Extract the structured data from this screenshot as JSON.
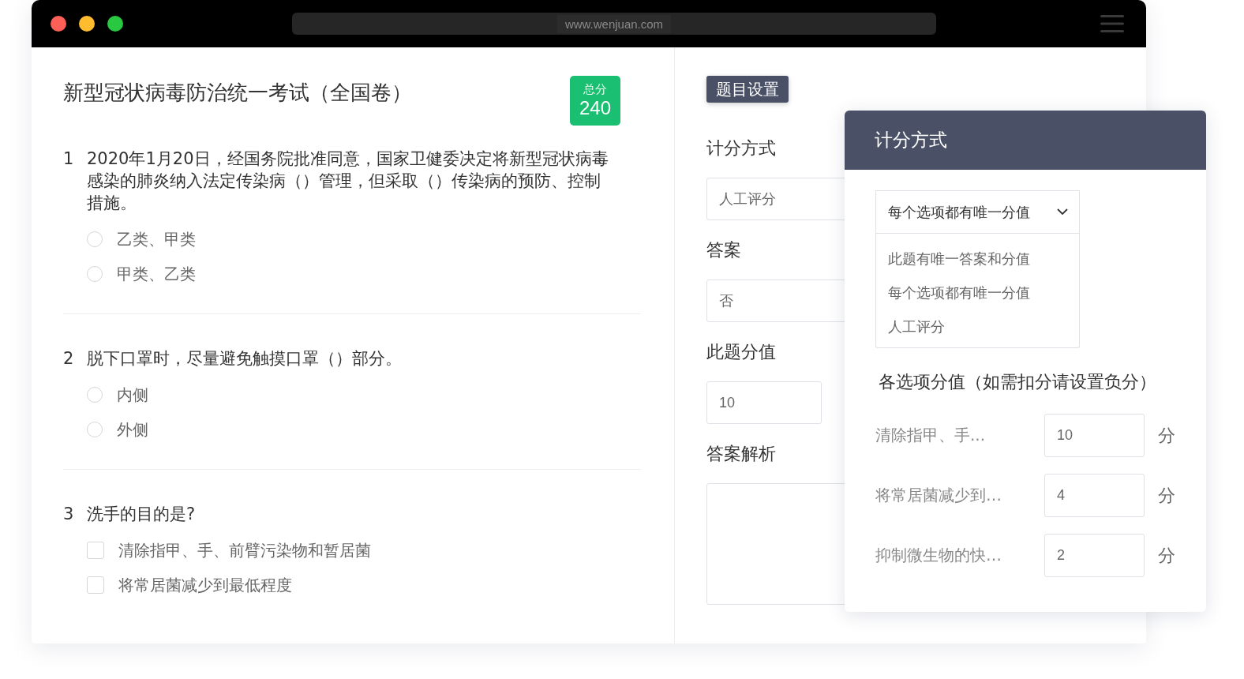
{
  "browser": {
    "url": "www.wenjuan.com"
  },
  "exam": {
    "title": "新型冠状病毒防治统一考试（全国卷）",
    "total_score": {
      "label": "总分",
      "value": "240"
    },
    "questions": [
      {
        "number": "1",
        "text": "2020年1月20日，经国务院批准同意，国家卫健委决定将新型冠状病毒感染的肺炎纳入法定传染病（）管理，但采取（）传染病的预防、控制措施。",
        "kind": "single",
        "options": [
          {
            "label": "乙类、甲类",
            "checked": false
          },
          {
            "label": "甲类、乙类",
            "checked": false
          }
        ]
      },
      {
        "number": "2",
        "text": "脱下口罩时，尽量避免触摸口罩（）部分。",
        "kind": "single",
        "options": [
          {
            "label": "内侧",
            "checked": false
          },
          {
            "label": "外侧",
            "checked": false
          }
        ]
      },
      {
        "number": "3",
        "text": "洗手的目的是?",
        "kind": "multiple",
        "options": [
          {
            "label": "清除指甲、手、前臂污染物和暂居菌",
            "checked": false
          },
          {
            "label": "将常居菌减少到最低程度",
            "checked": false
          }
        ]
      }
    ]
  },
  "settings": {
    "tab": "题目设置",
    "fields": [
      {
        "label": "计分方式",
        "kind": "select",
        "value": "人工评分"
      },
      {
        "label": "答案",
        "kind": "select",
        "value": "否"
      },
      {
        "label": "此题分值",
        "kind": "score",
        "value": "10"
      },
      {
        "label": "答案解析",
        "kind": "textarea"
      }
    ]
  },
  "scoring_popup": {
    "title": "计分方式",
    "select_value": "每个选项都有唯一分值",
    "options": [
      "此题有唯一答案和分值",
      "每个选项都有唯一分值",
      "人工评分"
    ],
    "section_title": "各选项分值（如需扣分请设置负分）",
    "option_scores": [
      {
        "label": "清除指甲、手...",
        "value": "10",
        "unit": "分"
      },
      {
        "label": "将常居菌减少到…",
        "value": "4",
        "unit": "分"
      },
      {
        "label": "抑制微生物的快…",
        "value": "2",
        "unit": "分"
      }
    ]
  }
}
